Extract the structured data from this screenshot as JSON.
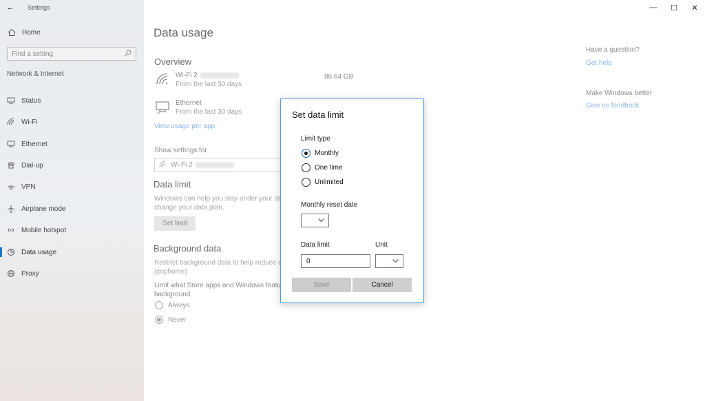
{
  "window": {
    "app_title": "Settings",
    "back_glyph": "←",
    "minimize_glyph": "—",
    "maximize_glyph": "☐",
    "close_glyph": "✕"
  },
  "sidebar": {
    "home": "Home",
    "search_placeholder": "Find a setting",
    "section": "Network & Internet",
    "items": [
      {
        "label": "Status",
        "icon": "status-icon"
      },
      {
        "label": "Wi-Fi",
        "icon": "wifi-icon"
      },
      {
        "label": "Ethernet",
        "icon": "ethernet-icon"
      },
      {
        "label": "Dial-up",
        "icon": "dialup-icon"
      },
      {
        "label": "VPN",
        "icon": "vpn-icon"
      },
      {
        "label": "Airplane mode",
        "icon": "airplane-icon"
      },
      {
        "label": "Mobile hotspot",
        "icon": "hotspot-icon"
      },
      {
        "label": "Data usage",
        "icon": "data-usage-icon",
        "active": true
      },
      {
        "label": "Proxy",
        "icon": "globe-icon"
      }
    ]
  },
  "main": {
    "title": "Data usage",
    "overview": "Overview",
    "wifi_name": "Wi-Fi 2",
    "wifi_sub": "From the last 30 days",
    "wifi_usage": "86.64 GB",
    "ethernet_name": "Ethernet",
    "ethernet_sub": "From the last 30 days",
    "view_usage_link": "View usage per app",
    "show_settings_for": "Show settings for",
    "network_dropdown": "Wi-Fi 2",
    "data_limit_heading": "Data limit",
    "data_limit_desc_1": "Windows can help you stay under your dat",
    "data_limit_desc_2": "change your data plan.",
    "set_limit_button": "Set limit",
    "background_heading": "Background data",
    "background_desc_1": "Restrict background data to help reduce d",
    "background_desc_2": "(cophome).",
    "limit_store_1": "Limit what Store apps and Windows featur",
    "limit_store_2": "background",
    "always": "Always",
    "never": "Never"
  },
  "right": {
    "question": "Have a question?",
    "get_help": "Get help",
    "make_better": "Make Windows better",
    "feedback": "Give us feedback"
  },
  "dialog": {
    "title": "Set data limit",
    "limit_type_label": "Limit type",
    "options": [
      "Monthly",
      "One time",
      "Unlimited"
    ],
    "selected_option": "Monthly",
    "reset_date_label": "Monthly reset date",
    "data_limit_label": "Data limit",
    "unit_label": "Unit",
    "data_limit_value": "0",
    "save_button": "Save",
    "cancel_button": "Cancel"
  },
  "colors": {
    "accent": "#1a73c4",
    "dialog_border": "#4f9ce0",
    "link": "#8ab6e4"
  }
}
